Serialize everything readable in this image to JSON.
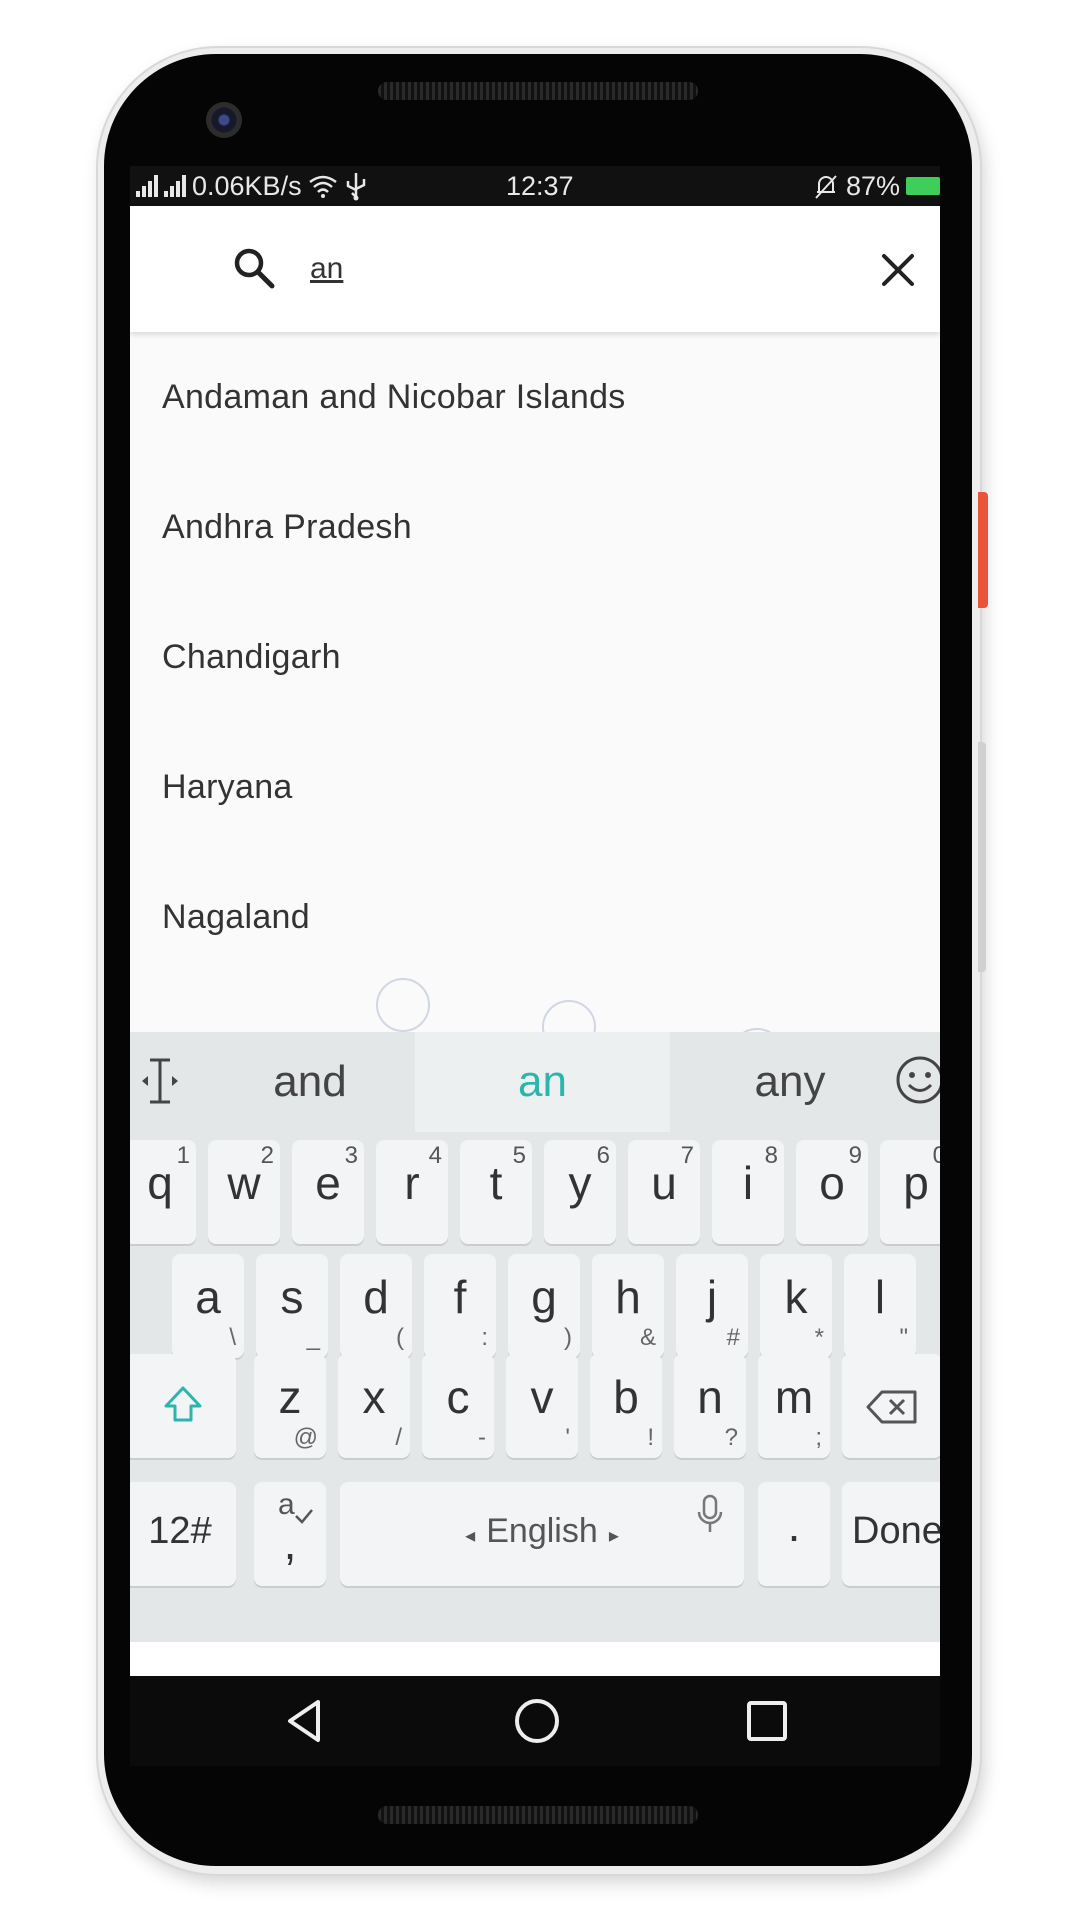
{
  "status_bar": {
    "network_speed": "0.06KB/s",
    "time": "12:37",
    "battery_percent": "87%",
    "battery_color": "#3fce5a"
  },
  "search": {
    "query": "an",
    "search_icon": "search-icon",
    "clear_icon": "close-icon"
  },
  "results": [
    "Andaman and Nicobar Islands",
    "Andhra Pradesh",
    "Chandigarh",
    "Haryana",
    "Nagaland"
  ],
  "keyboard": {
    "suggestions": [
      "and",
      "an",
      "any"
    ],
    "active_suggestion": "an",
    "accent_color": "#2bb5ad",
    "row1": [
      {
        "k": "q",
        "sup": "1"
      },
      {
        "k": "w",
        "sup": "2"
      },
      {
        "k": "e",
        "sup": "3"
      },
      {
        "k": "r",
        "sup": "4"
      },
      {
        "k": "t",
        "sup": "5"
      },
      {
        "k": "y",
        "sup": "6"
      },
      {
        "k": "u",
        "sup": "7"
      },
      {
        "k": "i",
        "sup": "8"
      },
      {
        "k": "o",
        "sup": "9"
      },
      {
        "k": "p",
        "sup": "0"
      }
    ],
    "row2": [
      {
        "k": "a",
        "sub": "\\"
      },
      {
        "k": "s",
        "sub": "_"
      },
      {
        "k": "d",
        "sub": "("
      },
      {
        "k": "f",
        "sub": ":"
      },
      {
        "k": "g",
        "sub": ")"
      },
      {
        "k": "h",
        "sub": "&"
      },
      {
        "k": "j",
        "sub": "#"
      },
      {
        "k": "k",
        "sub": "*"
      },
      {
        "k": "l",
        "sub": "\""
      }
    ],
    "row3": [
      {
        "k": "z",
        "sub": "@"
      },
      {
        "k": "x",
        "sub": "/"
      },
      {
        "k": "c",
        "sub": "-"
      },
      {
        "k": "v",
        "sub": "'"
      },
      {
        "k": "b",
        "sub": "!"
      },
      {
        "k": "n",
        "sub": "?"
      },
      {
        "k": "m",
        "sub": ";"
      }
    ],
    "symbols_label": "12#",
    "comma_label": ",",
    "comma_sup": "a",
    "space_label": "English",
    "period_label": ".",
    "done_label": "Done"
  },
  "nav": {
    "back_icon": "back-icon",
    "home_icon": "home-icon",
    "recent_icon": "recents-icon"
  }
}
